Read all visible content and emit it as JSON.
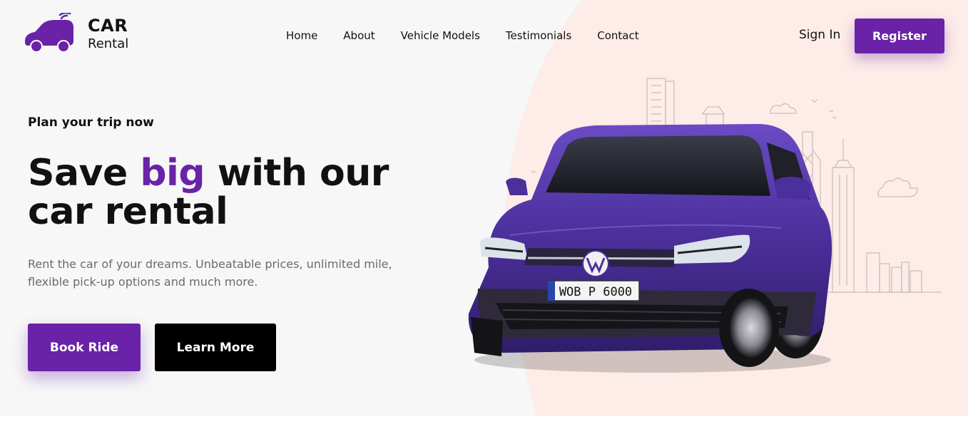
{
  "brand": {
    "line1": "CAR",
    "line2": "Rental"
  },
  "nav": {
    "items": [
      {
        "label": "Home"
      },
      {
        "label": "About"
      },
      {
        "label": "Vehicle Models"
      },
      {
        "label": "Testimonials"
      },
      {
        "label": "Contact"
      }
    ],
    "signin_label": "Sign In",
    "register_label": "Register"
  },
  "hero": {
    "eyebrow": "Plan your trip now",
    "headline_part1": "Save ",
    "headline_accent": "big",
    "headline_part2": " with our car rental",
    "description": "Rent the car of your dreams. Unbeatable prices, unlimited mile, flexible pick-up options and much more.",
    "book_label": "Book Ride",
    "learn_label": "Learn More",
    "plate_text": "WOB P 6000"
  },
  "colors": {
    "accent": "#6a22a8",
    "hero_bg": "#f7f7f7",
    "blob": "#fdece8",
    "car_body": "#4b2f9a"
  }
}
